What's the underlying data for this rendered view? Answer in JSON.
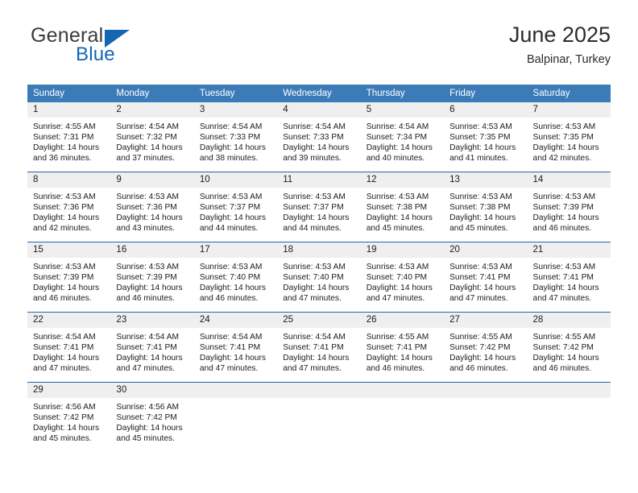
{
  "brand": {
    "name_top": "General",
    "name_bottom": "Blue",
    "triangle_color": "#1565b5",
    "text_color": "#3b3b3b"
  },
  "header": {
    "title": "June 2025",
    "subtitle": "Balpinar, Turkey"
  },
  "theme": {
    "header_bg": "#3b7cb8",
    "header_text": "#ffffff",
    "row_separator": "#1f69ad",
    "daynum_bg": "#efefef",
    "cell_bg": "#ffffff",
    "body_text": "#1c1c1c"
  },
  "weekday_headers": [
    "Sunday",
    "Monday",
    "Tuesday",
    "Wednesday",
    "Thursday",
    "Friday",
    "Saturday"
  ],
  "weeks": [
    [
      {
        "day": "1",
        "sunrise": "Sunrise: 4:55 AM",
        "sunset": "Sunset: 7:31 PM",
        "daylight_line1": "Daylight: 14 hours",
        "daylight_line2": "and 36 minutes."
      },
      {
        "day": "2",
        "sunrise": "Sunrise: 4:54 AM",
        "sunset": "Sunset: 7:32 PM",
        "daylight_line1": "Daylight: 14 hours",
        "daylight_line2": "and 37 minutes."
      },
      {
        "day": "3",
        "sunrise": "Sunrise: 4:54 AM",
        "sunset": "Sunset: 7:33 PM",
        "daylight_line1": "Daylight: 14 hours",
        "daylight_line2": "and 38 minutes."
      },
      {
        "day": "4",
        "sunrise": "Sunrise: 4:54 AM",
        "sunset": "Sunset: 7:33 PM",
        "daylight_line1": "Daylight: 14 hours",
        "daylight_line2": "and 39 minutes."
      },
      {
        "day": "5",
        "sunrise": "Sunrise: 4:54 AM",
        "sunset": "Sunset: 7:34 PM",
        "daylight_line1": "Daylight: 14 hours",
        "daylight_line2": "and 40 minutes."
      },
      {
        "day": "6",
        "sunrise": "Sunrise: 4:53 AM",
        "sunset": "Sunset: 7:35 PM",
        "daylight_line1": "Daylight: 14 hours",
        "daylight_line2": "and 41 minutes."
      },
      {
        "day": "7",
        "sunrise": "Sunrise: 4:53 AM",
        "sunset": "Sunset: 7:35 PM",
        "daylight_line1": "Daylight: 14 hours",
        "daylight_line2": "and 42 minutes."
      }
    ],
    [
      {
        "day": "8",
        "sunrise": "Sunrise: 4:53 AM",
        "sunset": "Sunset: 7:36 PM",
        "daylight_line1": "Daylight: 14 hours",
        "daylight_line2": "and 42 minutes."
      },
      {
        "day": "9",
        "sunrise": "Sunrise: 4:53 AM",
        "sunset": "Sunset: 7:36 PM",
        "daylight_line1": "Daylight: 14 hours",
        "daylight_line2": "and 43 minutes."
      },
      {
        "day": "10",
        "sunrise": "Sunrise: 4:53 AM",
        "sunset": "Sunset: 7:37 PM",
        "daylight_line1": "Daylight: 14 hours",
        "daylight_line2": "and 44 minutes."
      },
      {
        "day": "11",
        "sunrise": "Sunrise: 4:53 AM",
        "sunset": "Sunset: 7:37 PM",
        "daylight_line1": "Daylight: 14 hours",
        "daylight_line2": "and 44 minutes."
      },
      {
        "day": "12",
        "sunrise": "Sunrise: 4:53 AM",
        "sunset": "Sunset: 7:38 PM",
        "daylight_line1": "Daylight: 14 hours",
        "daylight_line2": "and 45 minutes."
      },
      {
        "day": "13",
        "sunrise": "Sunrise: 4:53 AM",
        "sunset": "Sunset: 7:38 PM",
        "daylight_line1": "Daylight: 14 hours",
        "daylight_line2": "and 45 minutes."
      },
      {
        "day": "14",
        "sunrise": "Sunrise: 4:53 AM",
        "sunset": "Sunset: 7:39 PM",
        "daylight_line1": "Daylight: 14 hours",
        "daylight_line2": "and 46 minutes."
      }
    ],
    [
      {
        "day": "15",
        "sunrise": "Sunrise: 4:53 AM",
        "sunset": "Sunset: 7:39 PM",
        "daylight_line1": "Daylight: 14 hours",
        "daylight_line2": "and 46 minutes."
      },
      {
        "day": "16",
        "sunrise": "Sunrise: 4:53 AM",
        "sunset": "Sunset: 7:39 PM",
        "daylight_line1": "Daylight: 14 hours",
        "daylight_line2": "and 46 minutes."
      },
      {
        "day": "17",
        "sunrise": "Sunrise: 4:53 AM",
        "sunset": "Sunset: 7:40 PM",
        "daylight_line1": "Daylight: 14 hours",
        "daylight_line2": "and 46 minutes."
      },
      {
        "day": "18",
        "sunrise": "Sunrise: 4:53 AM",
        "sunset": "Sunset: 7:40 PM",
        "daylight_line1": "Daylight: 14 hours",
        "daylight_line2": "and 47 minutes."
      },
      {
        "day": "19",
        "sunrise": "Sunrise: 4:53 AM",
        "sunset": "Sunset: 7:40 PM",
        "daylight_line1": "Daylight: 14 hours",
        "daylight_line2": "and 47 minutes."
      },
      {
        "day": "20",
        "sunrise": "Sunrise: 4:53 AM",
        "sunset": "Sunset: 7:41 PM",
        "daylight_line1": "Daylight: 14 hours",
        "daylight_line2": "and 47 minutes."
      },
      {
        "day": "21",
        "sunrise": "Sunrise: 4:53 AM",
        "sunset": "Sunset: 7:41 PM",
        "daylight_line1": "Daylight: 14 hours",
        "daylight_line2": "and 47 minutes."
      }
    ],
    [
      {
        "day": "22",
        "sunrise": "Sunrise: 4:54 AM",
        "sunset": "Sunset: 7:41 PM",
        "daylight_line1": "Daylight: 14 hours",
        "daylight_line2": "and 47 minutes."
      },
      {
        "day": "23",
        "sunrise": "Sunrise: 4:54 AM",
        "sunset": "Sunset: 7:41 PM",
        "daylight_line1": "Daylight: 14 hours",
        "daylight_line2": "and 47 minutes."
      },
      {
        "day": "24",
        "sunrise": "Sunrise: 4:54 AM",
        "sunset": "Sunset: 7:41 PM",
        "daylight_line1": "Daylight: 14 hours",
        "daylight_line2": "and 47 minutes."
      },
      {
        "day": "25",
        "sunrise": "Sunrise: 4:54 AM",
        "sunset": "Sunset: 7:41 PM",
        "daylight_line1": "Daylight: 14 hours",
        "daylight_line2": "and 47 minutes."
      },
      {
        "day": "26",
        "sunrise": "Sunrise: 4:55 AM",
        "sunset": "Sunset: 7:41 PM",
        "daylight_line1": "Daylight: 14 hours",
        "daylight_line2": "and 46 minutes."
      },
      {
        "day": "27",
        "sunrise": "Sunrise: 4:55 AM",
        "sunset": "Sunset: 7:42 PM",
        "daylight_line1": "Daylight: 14 hours",
        "daylight_line2": "and 46 minutes."
      },
      {
        "day": "28",
        "sunrise": "Sunrise: 4:55 AM",
        "sunset": "Sunset: 7:42 PM",
        "daylight_line1": "Daylight: 14 hours",
        "daylight_line2": "and 46 minutes."
      }
    ],
    [
      {
        "day": "29",
        "sunrise": "Sunrise: 4:56 AM",
        "sunset": "Sunset: 7:42 PM",
        "daylight_line1": "Daylight: 14 hours",
        "daylight_line2": "and 45 minutes."
      },
      {
        "day": "30",
        "sunrise": "Sunrise: 4:56 AM",
        "sunset": "Sunset: 7:42 PM",
        "daylight_line1": "Daylight: 14 hours",
        "daylight_line2": "and 45 minutes."
      },
      {
        "day": "",
        "sunrise": "",
        "sunset": "",
        "daylight_line1": "",
        "daylight_line2": "",
        "blank": true
      },
      {
        "day": "",
        "sunrise": "",
        "sunset": "",
        "daylight_line1": "",
        "daylight_line2": "",
        "blank": true
      },
      {
        "day": "",
        "sunrise": "",
        "sunset": "",
        "daylight_line1": "",
        "daylight_line2": "",
        "blank": true
      },
      {
        "day": "",
        "sunrise": "",
        "sunset": "",
        "daylight_line1": "",
        "daylight_line2": "",
        "blank": true
      },
      {
        "day": "",
        "sunrise": "",
        "sunset": "",
        "daylight_line1": "",
        "daylight_line2": "",
        "blank": true
      }
    ]
  ]
}
